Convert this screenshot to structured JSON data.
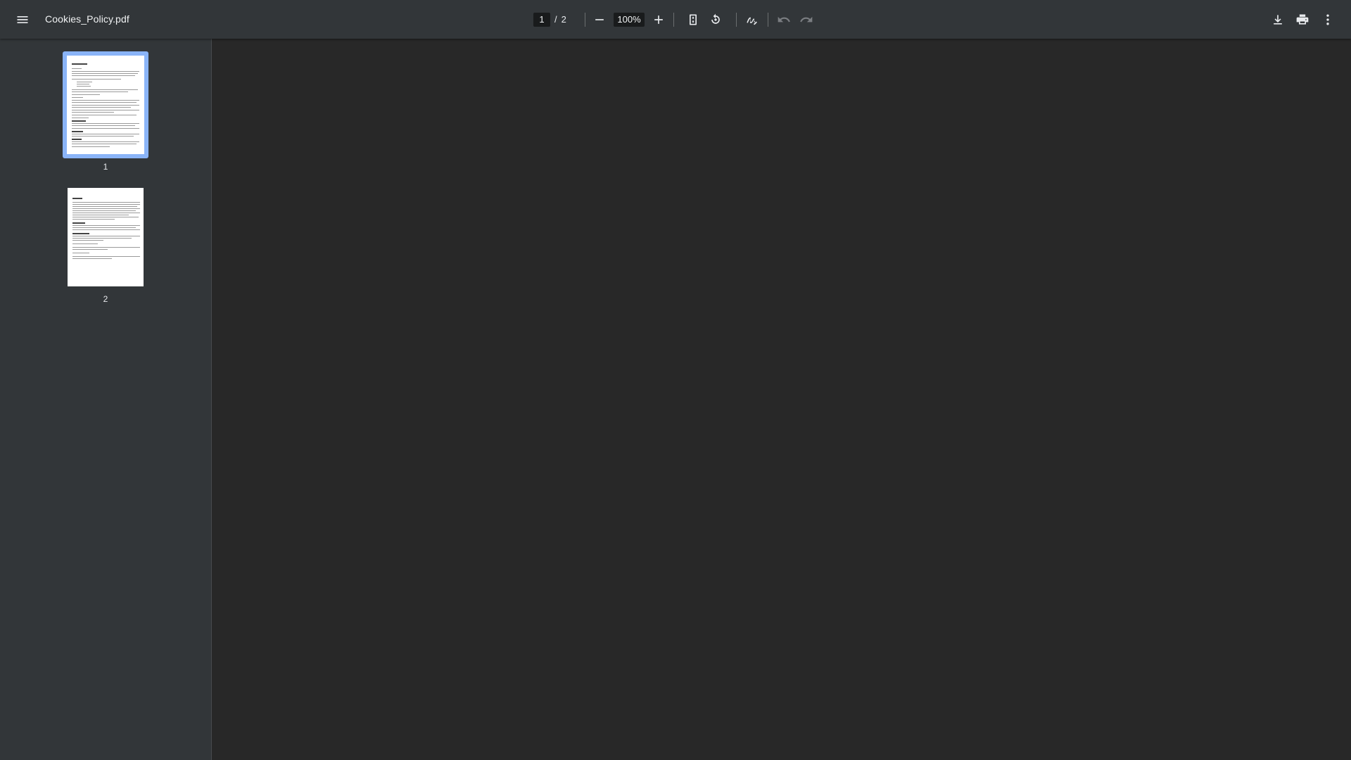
{
  "window": {
    "title": "Cookies_Policy.pdf"
  },
  "toolbar": {
    "menu_icon": "hamburger-menu-icon",
    "current_page": "1",
    "page_separator": "/",
    "total_pages": "2",
    "zoom": "100%",
    "icons": [
      "minus-icon",
      "plus-icon",
      "fit-page-icon",
      "rotate-icon",
      "annotate-icon",
      "undo-icon",
      "redo-icon",
      "download-icon",
      "print-icon",
      "more-vert-icon"
    ]
  },
  "sidebar": {
    "thumbnails": [
      {
        "label": "1",
        "selected": true
      },
      {
        "label": "2",
        "selected": false
      }
    ],
    "selected_color": "#8ab4f8"
  },
  "colors": {
    "toolbar_bg": "#323639",
    "viewer_bg": "#282828",
    "sidebar_bg": "#323639"
  }
}
